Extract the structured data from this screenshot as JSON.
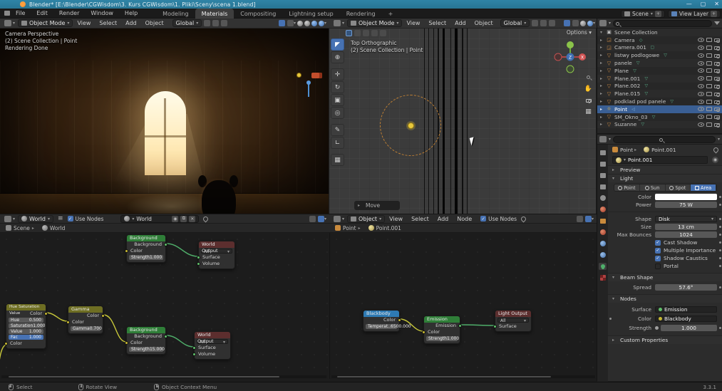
{
  "window": {
    "title": "Blender*  [E:\\Blender\\CGWisdom\\3. Kurs CGWisdom\\1. Pliki\\Sceny\\scena 1.blend]"
  },
  "topbar": {
    "menus": {
      "file": "File",
      "edit": "Edit",
      "render": "Render",
      "window": "Window",
      "help": "Help"
    },
    "workspaces": {
      "w0": "Modeling",
      "w1": "Materials",
      "w2": "Compositing",
      "w3": "Lightning setup",
      "w4": "Rendering",
      "new_tab": "+"
    },
    "scene": "Scene",
    "view_layer": "View Layer"
  },
  "vp_header": {
    "mode": "Object Mode",
    "view": "View",
    "select": "Select",
    "add": "Add",
    "object": "Object",
    "orientation": "Global"
  },
  "vp_left": {
    "line1": "Camera Perspective",
    "line2": "(2) Scene Collection | Point",
    "line3": "Rendering Done"
  },
  "vp_right": {
    "line1": "Top Orthographic",
    "line2": "(2) Scene Collection | Point",
    "options": "Options",
    "move_panel": "Move"
  },
  "outliner": {
    "root": "Scene Collection",
    "items": [
      {
        "name": "Camera"
      },
      {
        "name": "Camera.001"
      },
      {
        "name": "listwy podlogowe"
      },
      {
        "name": "panele"
      },
      {
        "name": "Plane"
      },
      {
        "name": "Plane.001"
      },
      {
        "name": "Plane.002"
      },
      {
        "name": "Plane.015"
      },
      {
        "name": "podklad pod panele"
      },
      {
        "name": "Point"
      },
      {
        "name": "SM_Okno_03"
      },
      {
        "name": "Suzanne"
      }
    ]
  },
  "props": {
    "breadcrumb": {
      "a": "Point",
      "b": "Point.001"
    },
    "datablock": "Point.001",
    "preview": "Preview",
    "light_panel": "Light",
    "tabs": {
      "point": "Point",
      "sun": "Sun",
      "spot": "Spot",
      "area": "Area"
    },
    "color_label": "Color",
    "power_label": "Power",
    "power": "75 W",
    "shape_label": "Shape",
    "shape": "Disk",
    "size_label": "Size",
    "size": "13 cm",
    "bounces_label": "Max Bounces",
    "bounces": "1024",
    "checks": [
      {
        "label": "Cast Shadow",
        "on": true
      },
      {
        "label": "Multiple Importance",
        "on": true
      },
      {
        "label": "Shadow Caustics",
        "on": true
      },
      {
        "label": "Portal",
        "on": false
      }
    ],
    "beam_panel": "Beam Shape",
    "spread_label": "Spread",
    "spread": "57.6°",
    "nodes_panel": "Nodes",
    "surface_label": "Surface",
    "surface": "Emission",
    "ncolor_label": "Color",
    "ncolor": "Blackbody",
    "strength_label": "Strength",
    "strength": "1.000",
    "custom_panel": "Custom Properties"
  },
  "shader_left": {
    "type": "World",
    "use_nodes": "Use Nodes",
    "datablock": "World",
    "path_a": "Scene",
    "path_b": "World",
    "bg1": {
      "title": "Background",
      "out": "Background",
      "color": "Color",
      "strength": "Strength",
      "strength_v": "1.000"
    },
    "out1": {
      "title": "World Output",
      "all": "All",
      "surface": "Surface",
      "volume": "Volume"
    },
    "hsv": {
      "title": "Hue Saturation Value",
      "out": "Color",
      "hue": "Hue",
      "hue_v": "0.500",
      "sat": "Saturation",
      "sat_v": "1.000",
      "val": "Value",
      "val_v": "1.000",
      "fac": "Fac",
      "fac_v": "1.000",
      "in": "Color"
    },
    "gamma": {
      "title": "Gamma",
      "out": "Color",
      "in": "Color",
      "g": "Gamma",
      "g_v": "0.700"
    },
    "bg2": {
      "title": "Background",
      "out": "Background",
      "color": "Color",
      "strength": "Strength",
      "strength_v": "15.000"
    },
    "out2": {
      "title": "World Output",
      "all": "All",
      "surface": "Surface",
      "volume": "Volume"
    }
  },
  "shader_right": {
    "type": "Object",
    "view": "View",
    "select": "Select",
    "add": "Add",
    "node": "Node",
    "use_nodes": "Use Nodes",
    "path_a": "Point",
    "path_b": "Point.001",
    "bb": {
      "title": "Blackbody",
      "out": "Color",
      "t": "Temperat..",
      "t_v": "6500.000"
    },
    "em": {
      "title": "Emission",
      "out": "Emission",
      "in": "Color",
      "s": "Strength",
      "s_v": "1.000"
    },
    "lo": {
      "title": "Light Output",
      "all": "All",
      "surface": "Surface"
    }
  },
  "status": {
    "select": "Select",
    "rotate": "Rotate View",
    "context": "Object Context Menu",
    "version": "3.3.1"
  }
}
